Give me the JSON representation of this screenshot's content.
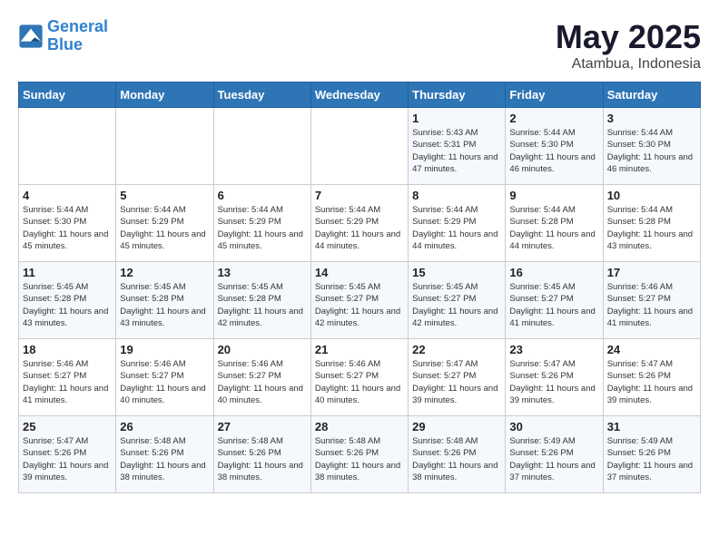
{
  "logo": {
    "line1": "General",
    "line2": "Blue"
  },
  "title": "May 2025",
  "subtitle": "Atambua, Indonesia",
  "days_of_week": [
    "Sunday",
    "Monday",
    "Tuesday",
    "Wednesday",
    "Thursday",
    "Friday",
    "Saturday"
  ],
  "weeks": [
    [
      {
        "day": "",
        "info": ""
      },
      {
        "day": "",
        "info": ""
      },
      {
        "day": "",
        "info": ""
      },
      {
        "day": "",
        "info": ""
      },
      {
        "day": "1",
        "info": "Sunrise: 5:43 AM\nSunset: 5:31 PM\nDaylight: 11 hours and 47 minutes."
      },
      {
        "day": "2",
        "info": "Sunrise: 5:44 AM\nSunset: 5:30 PM\nDaylight: 11 hours and 46 minutes."
      },
      {
        "day": "3",
        "info": "Sunrise: 5:44 AM\nSunset: 5:30 PM\nDaylight: 11 hours and 46 minutes."
      }
    ],
    [
      {
        "day": "4",
        "info": "Sunrise: 5:44 AM\nSunset: 5:30 PM\nDaylight: 11 hours and 45 minutes."
      },
      {
        "day": "5",
        "info": "Sunrise: 5:44 AM\nSunset: 5:29 PM\nDaylight: 11 hours and 45 minutes."
      },
      {
        "day": "6",
        "info": "Sunrise: 5:44 AM\nSunset: 5:29 PM\nDaylight: 11 hours and 45 minutes."
      },
      {
        "day": "7",
        "info": "Sunrise: 5:44 AM\nSunset: 5:29 PM\nDaylight: 11 hours and 44 minutes."
      },
      {
        "day": "8",
        "info": "Sunrise: 5:44 AM\nSunset: 5:29 PM\nDaylight: 11 hours and 44 minutes."
      },
      {
        "day": "9",
        "info": "Sunrise: 5:44 AM\nSunset: 5:28 PM\nDaylight: 11 hours and 44 minutes."
      },
      {
        "day": "10",
        "info": "Sunrise: 5:44 AM\nSunset: 5:28 PM\nDaylight: 11 hours and 43 minutes."
      }
    ],
    [
      {
        "day": "11",
        "info": "Sunrise: 5:45 AM\nSunset: 5:28 PM\nDaylight: 11 hours and 43 minutes."
      },
      {
        "day": "12",
        "info": "Sunrise: 5:45 AM\nSunset: 5:28 PM\nDaylight: 11 hours and 43 minutes."
      },
      {
        "day": "13",
        "info": "Sunrise: 5:45 AM\nSunset: 5:28 PM\nDaylight: 11 hours and 42 minutes."
      },
      {
        "day": "14",
        "info": "Sunrise: 5:45 AM\nSunset: 5:27 PM\nDaylight: 11 hours and 42 minutes."
      },
      {
        "day": "15",
        "info": "Sunrise: 5:45 AM\nSunset: 5:27 PM\nDaylight: 11 hours and 42 minutes."
      },
      {
        "day": "16",
        "info": "Sunrise: 5:45 AM\nSunset: 5:27 PM\nDaylight: 11 hours and 41 minutes."
      },
      {
        "day": "17",
        "info": "Sunrise: 5:46 AM\nSunset: 5:27 PM\nDaylight: 11 hours and 41 minutes."
      }
    ],
    [
      {
        "day": "18",
        "info": "Sunrise: 5:46 AM\nSunset: 5:27 PM\nDaylight: 11 hours and 41 minutes."
      },
      {
        "day": "19",
        "info": "Sunrise: 5:46 AM\nSunset: 5:27 PM\nDaylight: 11 hours and 40 minutes."
      },
      {
        "day": "20",
        "info": "Sunrise: 5:46 AM\nSunset: 5:27 PM\nDaylight: 11 hours and 40 minutes."
      },
      {
        "day": "21",
        "info": "Sunrise: 5:46 AM\nSunset: 5:27 PM\nDaylight: 11 hours and 40 minutes."
      },
      {
        "day": "22",
        "info": "Sunrise: 5:47 AM\nSunset: 5:27 PM\nDaylight: 11 hours and 39 minutes."
      },
      {
        "day": "23",
        "info": "Sunrise: 5:47 AM\nSunset: 5:26 PM\nDaylight: 11 hours and 39 minutes."
      },
      {
        "day": "24",
        "info": "Sunrise: 5:47 AM\nSunset: 5:26 PM\nDaylight: 11 hours and 39 minutes."
      }
    ],
    [
      {
        "day": "25",
        "info": "Sunrise: 5:47 AM\nSunset: 5:26 PM\nDaylight: 11 hours and 39 minutes."
      },
      {
        "day": "26",
        "info": "Sunrise: 5:48 AM\nSunset: 5:26 PM\nDaylight: 11 hours and 38 minutes."
      },
      {
        "day": "27",
        "info": "Sunrise: 5:48 AM\nSunset: 5:26 PM\nDaylight: 11 hours and 38 minutes."
      },
      {
        "day": "28",
        "info": "Sunrise: 5:48 AM\nSunset: 5:26 PM\nDaylight: 11 hours and 38 minutes."
      },
      {
        "day": "29",
        "info": "Sunrise: 5:48 AM\nSunset: 5:26 PM\nDaylight: 11 hours and 38 minutes."
      },
      {
        "day": "30",
        "info": "Sunrise: 5:49 AM\nSunset: 5:26 PM\nDaylight: 11 hours and 37 minutes."
      },
      {
        "day": "31",
        "info": "Sunrise: 5:49 AM\nSunset: 5:26 PM\nDaylight: 11 hours and 37 minutes."
      }
    ]
  ]
}
